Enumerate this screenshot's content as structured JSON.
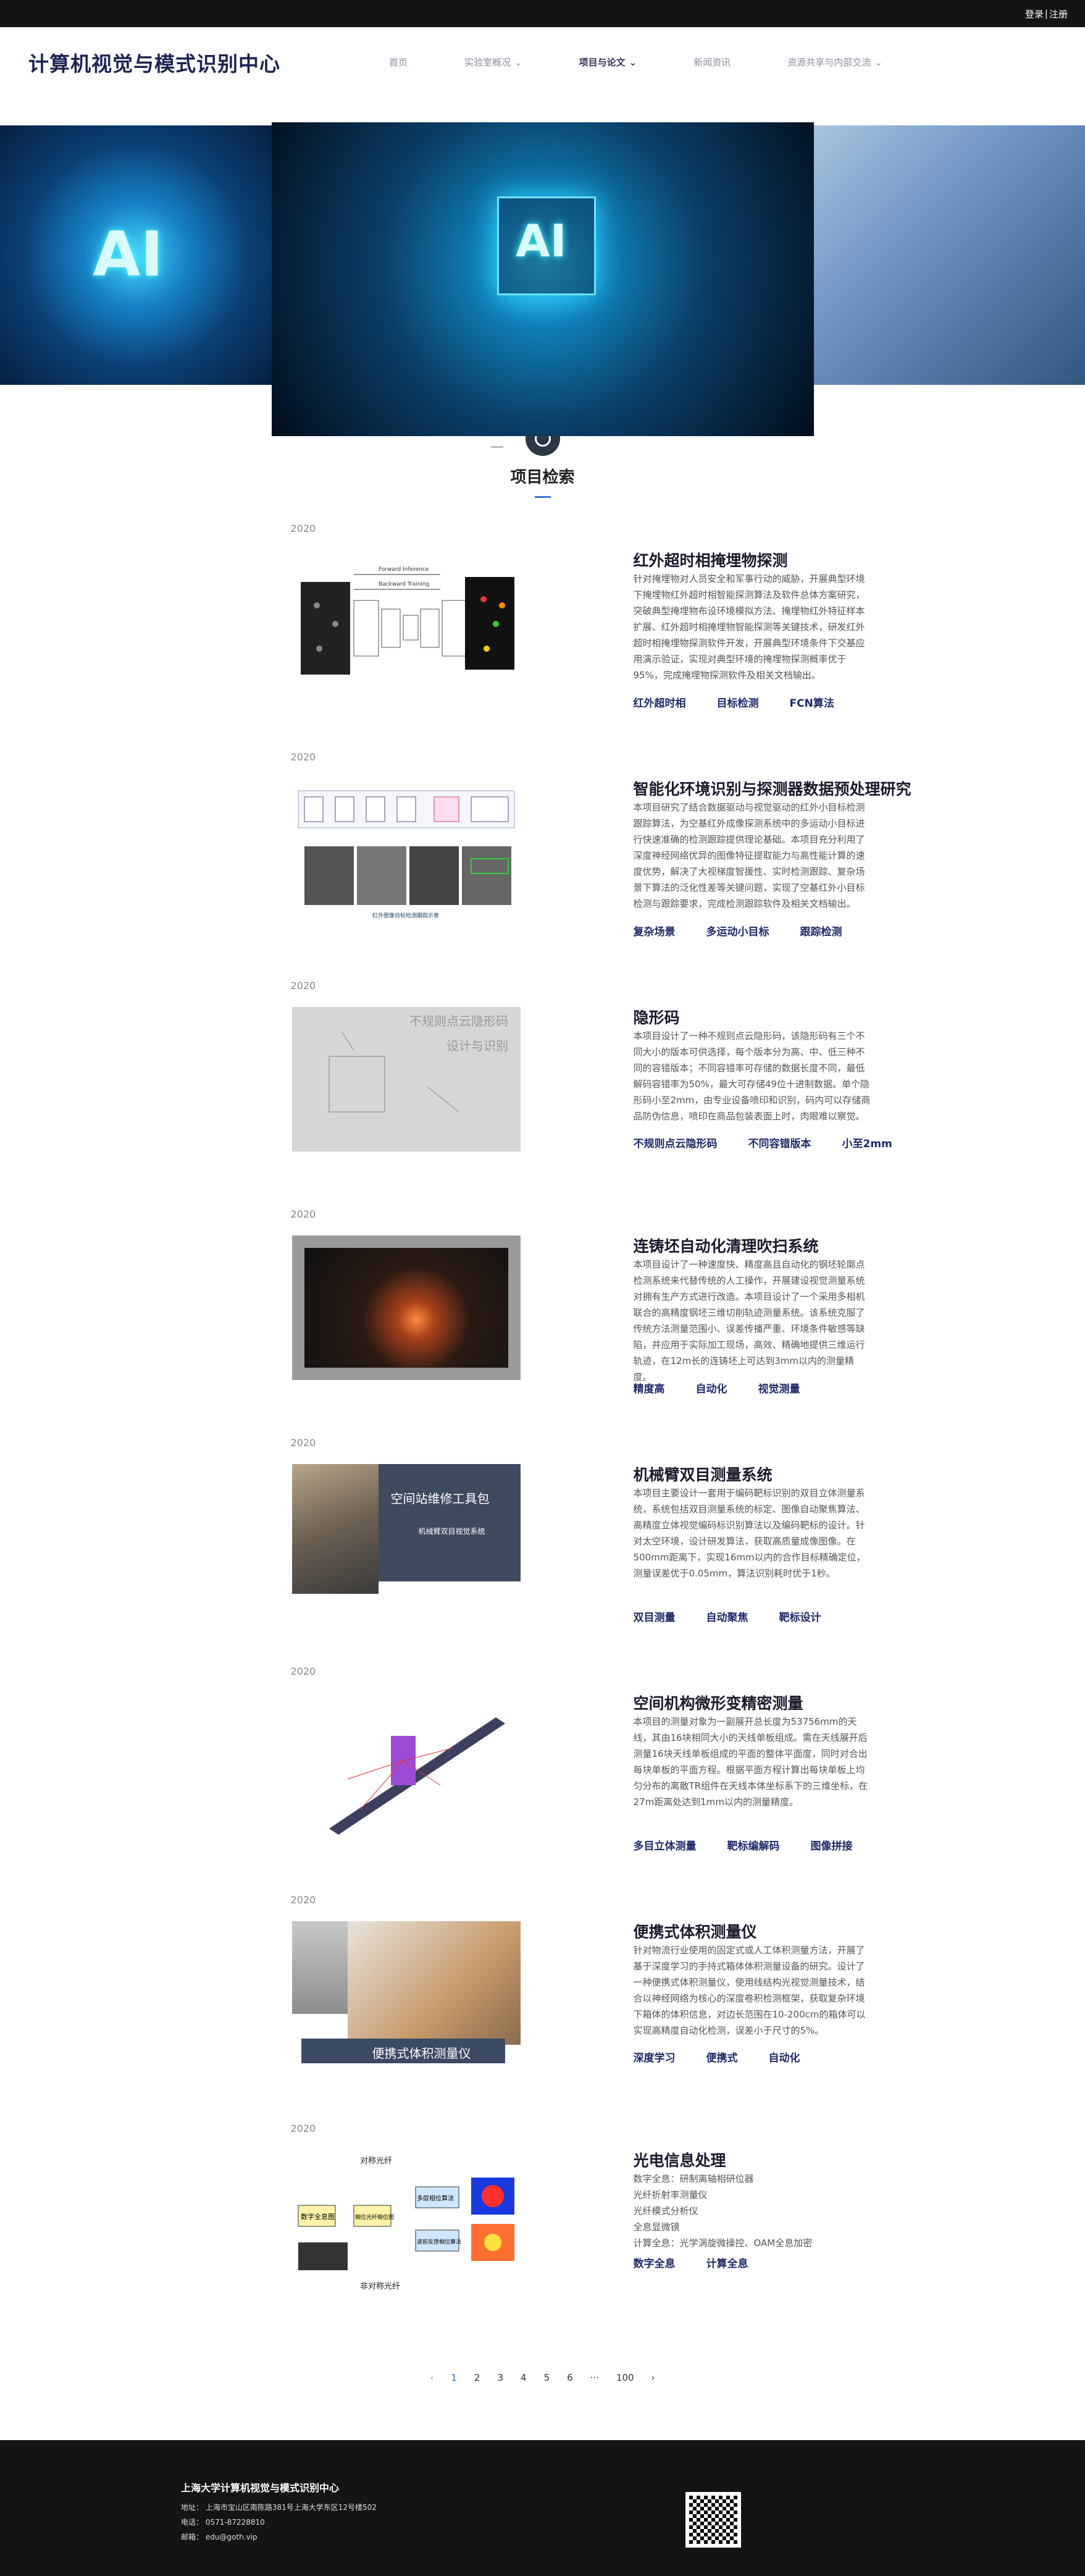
{
  "topbar": {
    "login": "登录",
    "sep": "|",
    "register": "注册"
  },
  "header": {
    "logo": "计算机视觉与模式识别中心",
    "nav": [
      {
        "label": "首页",
        "has_arrow": false
      },
      {
        "label": "实验室概况",
        "has_arrow": true
      },
      {
        "label": "项目与论文",
        "has_arrow": true
      },
      {
        "label": "新闻资讯",
        "has_arrow": false
      },
      {
        "label": "资源共享与内部交流",
        "has_arrow": true
      }
    ]
  },
  "hero": {
    "left_text": "AI",
    "center_text": "AI"
  },
  "section": {
    "title": "项目检索"
  },
  "projects": [
    {
      "year": "2020",
      "title": "红外超时相掩埋物探测",
      "desc": "针对掩埋物对人员安全和军事行动的威胁，开展典型环境下掩埋物红外超时相智能探测算法及软件总体方案研究，突破典型掩埋物布设环境模拟方法、掩埋物红外特征样本扩展、红外超时相掩埋物智能探测等关键技术，研发红外超时相掩埋物探测软件开发，开展典型环境条件下交基应用演示验证，实现对典型环境的掩埋物探测概率优于95%，完成掩埋物探测软件及相关文档输出。",
      "tags": [
        "红外超时相",
        "目标检测",
        "FCN算法"
      ]
    },
    {
      "year": "2020",
      "title": "智能化环境识别与探测器数据预处理研究",
      "desc": "本项目研究了结合数据驱动与视觉驱动的红外小目标检测跟踪算法，为空基红外成像探测系统中的多运动小目标进行快速准确的检测跟踪提供理论基础。本项目充分利用了深度神经网络优异的图像特征提取能力与高性能计算的速度优势，解决了大视梯度智援性、实时检测跟踪、复杂场景下算法的泛化性差等关键问题，实现了空基红外小目标检测与跟踪要求，完成检测跟踪软件及相关文档输出。",
      "tags": [
        "复杂场景",
        "多运动小目标",
        "跟踪检测"
      ]
    },
    {
      "year": "2020",
      "title": "隐形码",
      "desc": "本项目设计了一种不规则点云隐形码，该隐形码有三个不同大小的版本可供选择，每个版本分为高、中、低三种不同的容错版本；不同容错率可存储的数据长度不同，最低解码容错率为50%，最大可存储49位十进制数据。单个隐形码小至2mm，由专业设备喷印和识别，码内可以存储商品防伪信息，喷印在商品包装表面上时，肉眼难以察觉。",
      "tags": [
        "不规则点云隐形码",
        "不同容错版本",
        "小至2mm"
      ]
    },
    {
      "year": "2020",
      "title": "连铸坯自动化清理吹扫系统",
      "desc": "本项目设计了一种速度快、精度高且自动化的钢坯轮廓点检测系统来代替传统的人工操作，开展建设视觉测量系统对拥有生产方式进行改造。本项目设计了一个采用多相机联合的高精度钢坯三维切削轨迹测量系统。该系统克服了传统方法测量范围小、误差传播严重、环境条件敏感等缺陷，并应用于实际加工现场，高效、精确地提供三维运行轨迹，在12m长的连铸坯上可达到3mm以内的测量精度。",
      "tags": [
        "精度高",
        "自动化",
        "视觉测量"
      ]
    },
    {
      "year": "2020",
      "title": "机械臂双目测量系统",
      "desc": "本项目主要设计一套用于编码靶标识别的双目立体测量系统，系统包括双目测量系统的标定、图像自动聚焦算法、高精度立体视觉编码标识别算法以及编码靶标的设计。针对太空环境，设计研发算法，获取高质量成像图像。在500mm距离下，实现16mm以内的合作目标精确定位，测量误差优于0.05mm，算法识别耗时优于1秒。",
      "tags": [
        "双目测量",
        "自动聚焦",
        "靶标设计"
      ]
    },
    {
      "year": "2020",
      "title": "空间机构微形变精密测量",
      "desc": "本项目的测量对象为一副展开总长度为53756mm的天线，其由16块相同大小的天线单板组成。需在天线展开后测量16块天线单板组成的平面的整体平面度，同时对合出每块单板的平面方程。根据平面方程计算出每块单板上均匀分布的离散TR组件在天线本体坐标系下的三维坐标，在27m距离处达到1mm以内的测量精度。",
      "tags": [
        "多目立体测量",
        "靶标编解码",
        "图像拼接"
      ]
    },
    {
      "year": "2020",
      "title": "便携式体积测量仪",
      "desc": "针对物流行业使用的固定式或人工体积测量方法，开展了基于深度学习的手持式箱体体积测量设备的研究。设计了一种便携式体积测量仪，使用线结构光视觉测量技术，结合以神经网络为核心的深度卷积检测框架，获取复杂环境下箱体的体积信息，对边长范围在10-200cm的箱体可以实现高精度自动化检测，误差小于尺寸的5%。",
      "tags": [
        "深度学习",
        "便携式",
        "自动化"
      ]
    },
    {
      "year": "2020",
      "title": "光电信息处理",
      "desc_lines": [
        "数字全息：研制离轴相研位器",
        "光纤折射率测量仪",
        "光纤模式分析仪",
        "全息显微镜",
        "计算全息：光学涡旋微操控、OAM全息加密"
      ],
      "tags": [
        "数字全息",
        "计算全息"
      ]
    }
  ],
  "images": [
    {
      "caption": "Forward Inference",
      "caption2": "Backward Training"
    },
    {
      "caption": "红外图像目标检测跟踪示意"
    },
    {
      "label1": "不规则点云隐形码",
      "label2": "设计与识别"
    },
    {},
    {
      "label1": "空间站维修工具包",
      "label2": "机械臂双目视觉系统"
    },
    {},
    {
      "label1": "便携式体积测量仪"
    },
    {
      "l1": "对称光纤",
      "l2": "数字全息图",
      "l3": "相位光纤相位图",
      "l4": "多层相位算法",
      "l5": "波前反馈相位算法",
      "l6": "非对称光纤"
    }
  ],
  "pagination": {
    "prev": "‹",
    "pages": [
      "1",
      "2",
      "3",
      "4",
      "5",
      "6"
    ],
    "ellipsis": "···",
    "last": "100",
    "next": "›",
    "current": "1"
  },
  "footer": {
    "title": "上海大学计算机视觉与模式识别中心",
    "address": "地址： 上海市宝山区南陈路381号上海大学东区12号楼502",
    "phone": "电话： 0571-87228810",
    "email": "邮箱： edu@goth.vip"
  }
}
